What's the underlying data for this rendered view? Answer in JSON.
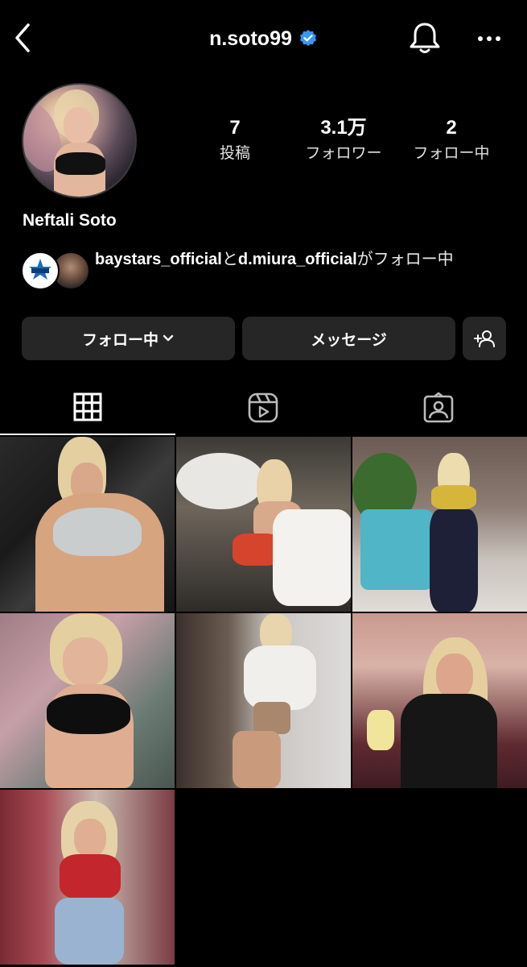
{
  "header": {
    "username": "n.soto99",
    "verified": true,
    "back_icon": "chevron-left-icon",
    "bell_icon": "bell-icon",
    "more_icon": "more-horizontal-icon"
  },
  "profile": {
    "display_name": "Neftali Soto",
    "stats": [
      {
        "value": "7",
        "label": "投稿"
      },
      {
        "value": "3.1万",
        "label": "フォロワー"
      },
      {
        "value": "2",
        "label": "フォロー中"
      }
    ]
  },
  "followed_by": {
    "user1": "baystars_official",
    "joiner": "と",
    "user2": "d.miura_official",
    "suffix": "がフォロー中"
  },
  "buttons": {
    "following": "フォロー中",
    "message": "メッセージ",
    "add_person_icon": "add-person-icon"
  },
  "tabs": [
    {
      "icon": "grid-icon",
      "active": true
    },
    {
      "icon": "reels-icon",
      "active": false
    },
    {
      "icon": "tagged-icon",
      "active": false
    }
  ],
  "colors": {
    "background": "#000000",
    "button_bg": "#262626",
    "verified_blue": "#3897f0",
    "text": "#ffffff"
  }
}
